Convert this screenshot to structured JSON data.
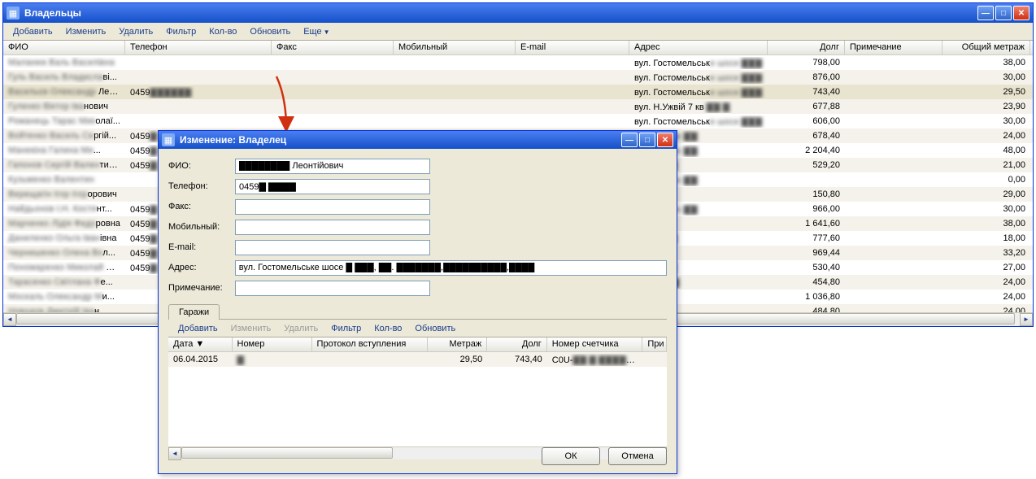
{
  "main_window": {
    "title": "Владельцы",
    "menu": [
      "Добавить",
      "Изменить",
      "Удалить",
      "Фильтр",
      "Кол-во",
      "Обновить",
      "Еще"
    ],
    "columns": [
      "ФИО",
      "Телефон",
      "Факс",
      "Мобильный",
      "E-mail",
      "Адрес",
      "Долг",
      "Примечание",
      "Общий метраж"
    ],
    "rows": [
      {
        "fio_blur": "Маланюк Валь Василівна",
        "fio_suffix": "",
        "phone": "",
        "addr_prefix": "вул. Гостомельськ",
        "addr_blur": "е шосе ▇▇▇",
        "debt": "798,00",
        "metr": "38,00"
      },
      {
        "fio_blur": "Гуль Василь Владисла",
        "fio_suffix": "ві...",
        "phone": "",
        "addr_prefix": "вул. Гостомельськ",
        "addr_blur": "е шосе ▇▇▇",
        "debt": "876,00",
        "metr": "30,00"
      },
      {
        "fio_blur": "Васильєв Олександр",
        "fio_suffix": " Лео...",
        "phone": "0459▇▇▇▇▇▇",
        "addr_prefix": "вул. Гостомельськ",
        "addr_blur": "е шосе ▇▇▇",
        "debt": "743,40",
        "metr": "29,50",
        "selected": true
      },
      {
        "fio_blur": "Гуленко Віктор Іва",
        "fio_suffix": "нович",
        "phone": "",
        "addr_prefix": "вул. Н.Ужвій 7 кв",
        "addr_blur": " ▇▇ ▇",
        "debt": "677,88",
        "metr": "23,90"
      },
      {
        "fio_blur": "Романець Тарас Мик",
        "fio_suffix": "олаї...",
        "phone": "",
        "addr_prefix": "вул. Гостомельськ",
        "addr_blur": "е шосе ▇▇▇",
        "debt": "606,00",
        "metr": "30,00"
      },
      {
        "fio_blur": "Войтенко Василь Се",
        "fio_suffix": "ргій...",
        "phone": "0459▇",
        "addr_prefix": "",
        "addr_blur": "ьське шосе ▇▇",
        "debt": "678,40",
        "metr": "24,00"
      },
      {
        "fio_blur": "Манекіна Галина Ми",
        "fio_suffix": "...",
        "phone": "0459▇",
        "addr_prefix": "",
        "addr_blur": "ьське шосе ▇▇",
        "debt": "2 204,40",
        "metr": "48,00"
      },
      {
        "fio_blur": "Гапонов Сергій Вален",
        "fio_suffix": "тинович",
        "phone": "0459▇",
        "addr_prefix": "",
        "addr_blur": "а 9▇, кв.▇",
        "debt": "529,20",
        "metr": "21,00"
      },
      {
        "fio_blur": "Кузьменко Валентин",
        "fio_suffix": "",
        "phone": "",
        "addr_prefix": "",
        "addr_blur": "ьське шосе ▇▇",
        "debt": "",
        "metr": "0,00"
      },
      {
        "fio_blur": "Верещагін Ігор Ігор",
        "fio_suffix": "орович",
        "phone": "",
        "addr_prefix": "",
        "addr_blur": "льна пер.",
        "debt": "150,80",
        "metr": "29,00"
      },
      {
        "fio_blur": "Найдьонов І.Н. Костя",
        "fio_suffix": "нт...",
        "phone": "0459▇",
        "addr_prefix": "",
        "addr_blur": "ьське шосе ▇▇",
        "debt": "966,00",
        "metr": "30,00"
      },
      {
        "fio_blur": "Марченко Лідія Федо",
        "fio_suffix": "ровна",
        "phone": "0459▇",
        "addr_prefix": "",
        "addr_blur": "ьська ▇▇",
        "debt": "1 641,60",
        "metr": "38,00"
      },
      {
        "fio_blur": "Даниленко Ольга Іван",
        "fio_suffix": "івна",
        "phone": "0459▇",
        "addr_prefix": "",
        "addr_blur": "а 1▇, кв.▇",
        "debt": "777,60",
        "metr": "18,00"
      },
      {
        "fio_blur": "Чернишенко Олена Во",
        "fio_suffix": "л...",
        "phone": "0459▇",
        "addr_prefix": "",
        "addr_blur": "ьська ▇▇",
        "debt": "969,44",
        "metr": "33,20"
      },
      {
        "fio_blur": "Пономаренко Миколай",
        "fio_suffix": " Андр...",
        "phone": "0459▇",
        "addr_prefix": "",
        "addr_blur": "ьська ▇ ▇",
        "debt": "530,40",
        "metr": "27,00"
      },
      {
        "fio_blur": "Тарасенко Світлана Ф",
        "fio_suffix": "е...",
        "phone": "",
        "addr_prefix": "",
        "addr_blur": "шосе ▇▇▇",
        "debt": "454,80",
        "metr": "24,00"
      },
      {
        "fio_blur": "Москаль Олександр М",
        "fio_suffix": "и...",
        "phone": "",
        "addr_prefix": "",
        "addr_blur": "ьська ▇▇",
        "debt": "1 036,80",
        "metr": "24,00"
      },
      {
        "fio_blur": "Новодов Дмитрій Іва",
        "fio_suffix": "н...",
        "phone": "",
        "addr_prefix": "",
        "addr_blur": "ьська ▇▇",
        "debt": "484,80",
        "metr": "24,00"
      }
    ]
  },
  "dialog": {
    "title": "Изменение: Владелец",
    "labels": {
      "fio": "ФИО:",
      "phone": "Телефон:",
      "fax": "Факс:",
      "mobile": "Мобильный:",
      "email": "E-mail:",
      "address": "Адрес:",
      "note": "Примечание:"
    },
    "values": {
      "fio_blur": "▇▇▇▇▇▇ ▇▇▇▇▇▇▇",
      "fio_suffix": " Леонтійович",
      "phone": "0459▇ ▇▇▇▇",
      "fax": "",
      "mobile": "",
      "email": "",
      "address_prefix": "вул. Гостомельське шосе ",
      "address_blur": "1 ▇▇▇, ▇▇. ▇▇▇▇▇▇▇,▇▇▇▇▇▇▇▇▇▇,▇▇▇▇",
      "note": ""
    },
    "tab_label": "Гаражи",
    "sub_menu": [
      "Добавить",
      "Изменить",
      "Удалить",
      "Фильтр",
      "Кол-во",
      "Обновить"
    ],
    "sub_columns": [
      "Дата ▼",
      "Номер",
      "Протокол вступления",
      "Метраж",
      "Долг",
      "Номер счетчика",
      "При"
    ],
    "sub_row": {
      "date": "06.04.2015",
      "number": "▇",
      "protocol": "",
      "metr": "29,50",
      "debt": "743,40",
      "meter_prefix": "C0U-",
      "meter_blur": "▇▇ ▇ ▇▇▇▇▇▇"
    },
    "buttons": {
      "ok": "ОК",
      "cancel": "Отмена"
    }
  }
}
